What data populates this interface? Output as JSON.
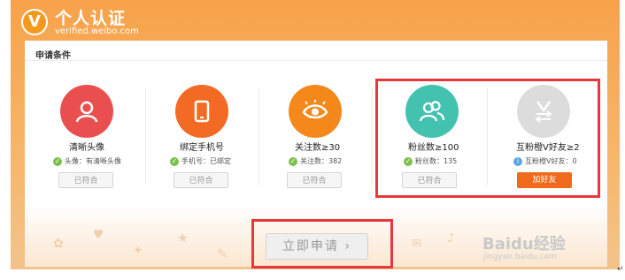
{
  "header": {
    "logo_letter": "V",
    "title": "个人认证",
    "subtitle": "verified.weibo.com"
  },
  "section": {
    "title": "申请条件"
  },
  "cards": [
    {
      "title": "清晰头像",
      "status": "头像：有清晰头像",
      "status_icon": "check-icon",
      "button": "已符合",
      "icon": "user-icon",
      "color": "#ea4f4f"
    },
    {
      "title": "绑定手机号",
      "status": "手机号：已绑定",
      "status_icon": "check-icon",
      "button": "已符合",
      "icon": "tablet-icon",
      "color": "#f26a24"
    },
    {
      "title": "关注数≥30",
      "status": "关注数：382",
      "status_icon": "check-icon",
      "button": "已符合",
      "icon": "eye-icon",
      "color": "#f5881a"
    },
    {
      "title": "粉丝数≥100",
      "status": "粉丝数：135",
      "status_icon": "check-icon",
      "button": "已符合",
      "icon": "users-icon",
      "color": "#44c2b0"
    },
    {
      "title": "互粉橙V好友≥2",
      "status": "互粉橙V好友：0",
      "status_icon": "info-icon",
      "button": "加好友",
      "icon": "mutual-v-icon",
      "color": "#dcdcdc"
    }
  ],
  "apply": {
    "label": "立即申请 ›"
  },
  "watermark": {
    "main": "Baidu经验",
    "sub": "jingyan.baidu.com"
  },
  "colors": {
    "accent": "#f39a1d",
    "highlight": "#e8383d",
    "check": "#7cc04b",
    "add_button": "#f06a1e"
  }
}
